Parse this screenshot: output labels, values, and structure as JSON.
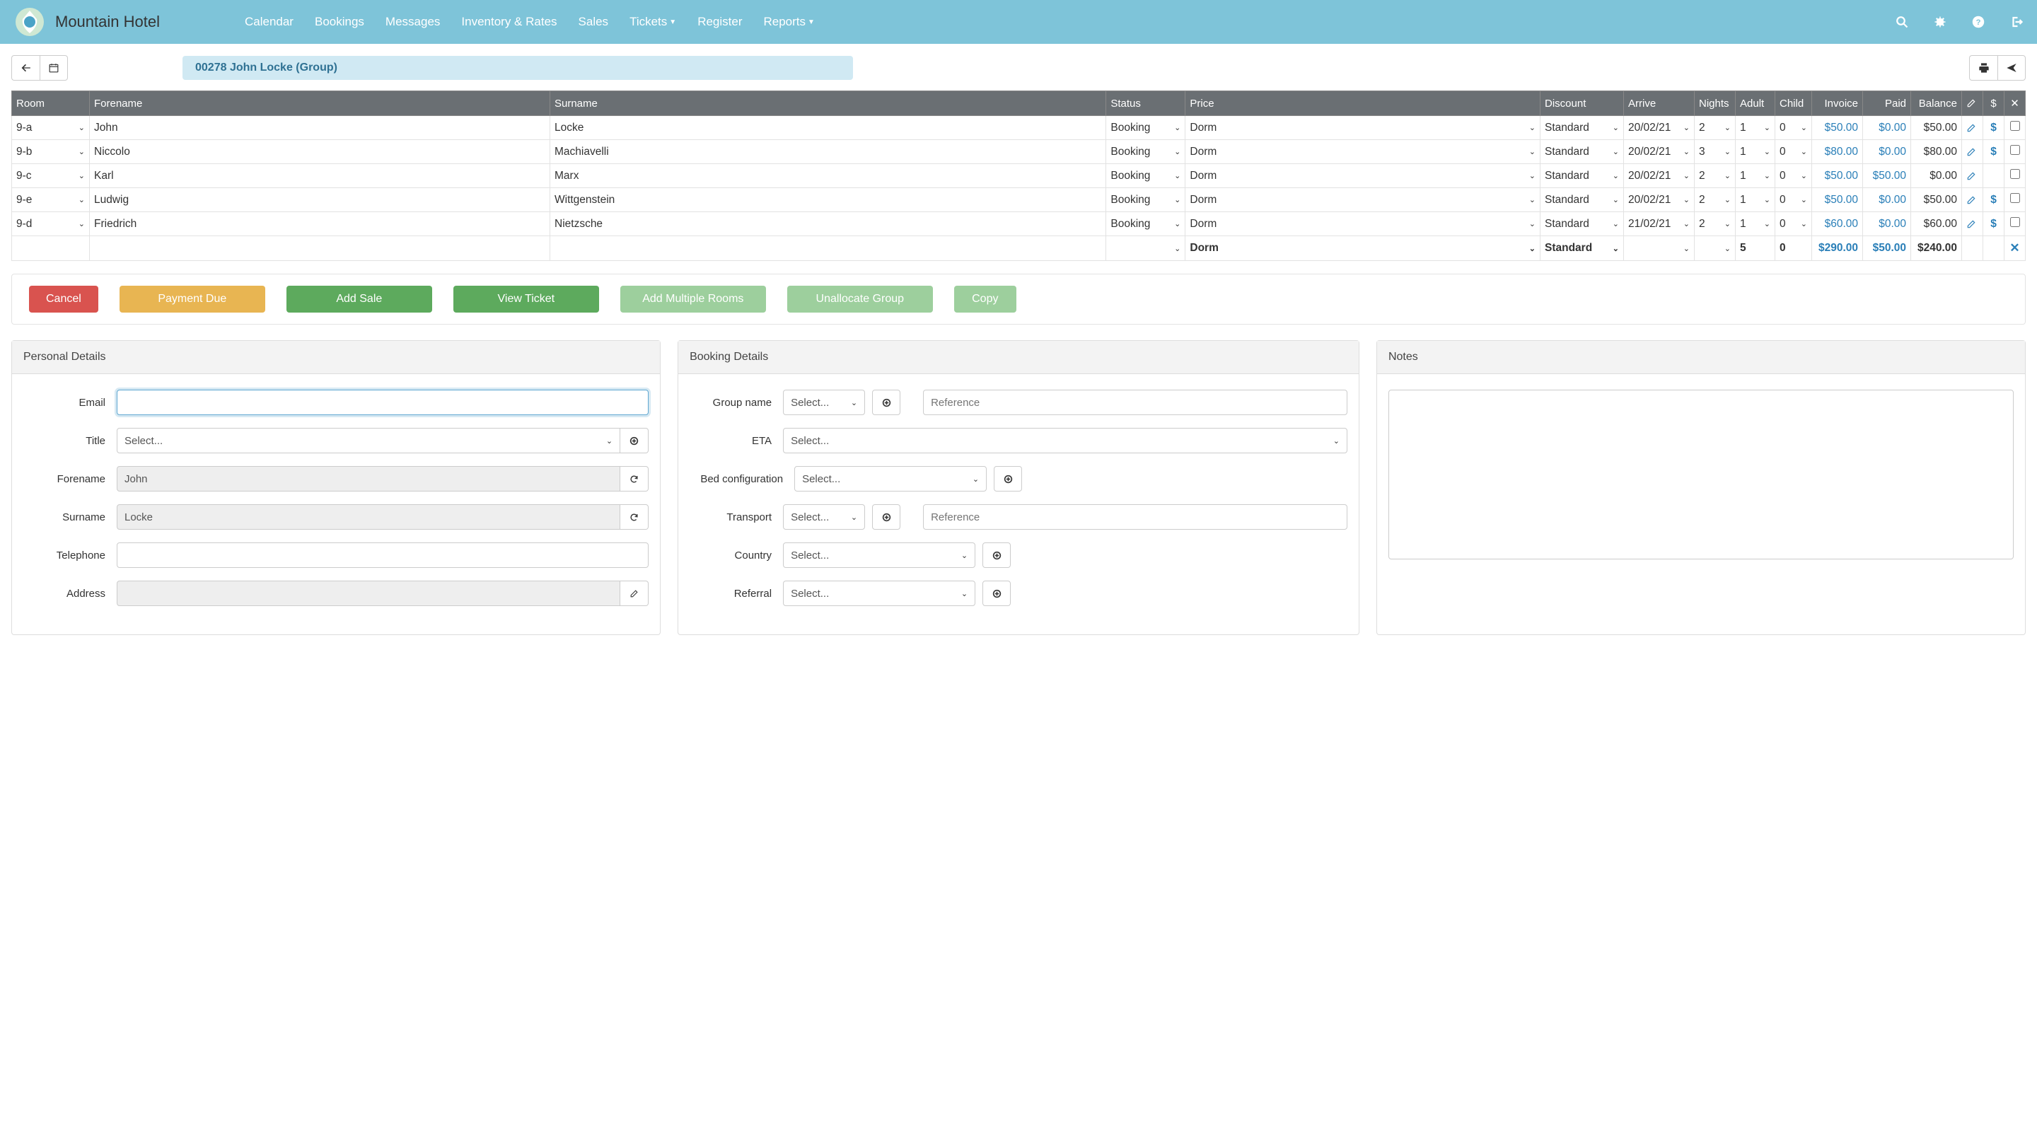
{
  "brand": "Mountain Hotel",
  "nav": {
    "items": [
      "Calendar",
      "Bookings",
      "Messages",
      "Inventory & Rates",
      "Sales",
      "Tickets",
      "Register",
      "Reports"
    ],
    "dropdown_flags": [
      false,
      false,
      false,
      false,
      false,
      true,
      false,
      true
    ]
  },
  "booking_pill": "00278  John Locke  (Group)",
  "columns": [
    "Room",
    "Forename",
    "Surname",
    "Status",
    "Price",
    "Discount",
    "Arrive",
    "Nights",
    "Adult",
    "Child",
    "Invoice",
    "Paid",
    "Balance"
  ],
  "rows": [
    {
      "room": "9-a",
      "forename": "John",
      "surname": "Locke",
      "status": "Booking",
      "price": "Dorm",
      "discount": "Standard",
      "arrive": "20/02/21",
      "nights": "2",
      "adult": "1",
      "child": "0",
      "invoice": "$50.00",
      "paid": "$0.00",
      "balance": "$50.00",
      "show_dollar": true
    },
    {
      "room": "9-b",
      "forename": "Niccolo",
      "surname": "Machiavelli",
      "status": "Booking",
      "price": "Dorm",
      "discount": "Standard",
      "arrive": "20/02/21",
      "nights": "3",
      "adult": "1",
      "child": "0",
      "invoice": "$80.00",
      "paid": "$0.00",
      "balance": "$80.00",
      "show_dollar": true
    },
    {
      "room": "9-c",
      "forename": "Karl",
      "surname": "Marx",
      "status": "Booking",
      "price": "Dorm",
      "discount": "Standard",
      "arrive": "20/02/21",
      "nights": "2",
      "adult": "1",
      "child": "0",
      "invoice": "$50.00",
      "paid": "$50.00",
      "balance": "$0.00",
      "show_dollar": false
    },
    {
      "room": "9-e",
      "forename": "Ludwig",
      "surname": "Wittgenstein",
      "status": "Booking",
      "price": "Dorm",
      "discount": "Standard",
      "arrive": "20/02/21",
      "nights": "2",
      "adult": "1",
      "child": "0",
      "invoice": "$50.00",
      "paid": "$0.00",
      "balance": "$50.00",
      "show_dollar": true
    },
    {
      "room": "9-d",
      "forename": "Friedrich",
      "surname": "Nietzsche",
      "status": "Booking",
      "price": "Dorm",
      "discount": "Standard",
      "arrive": "21/02/21",
      "nights": "2",
      "adult": "1",
      "child": "0",
      "invoice": "$60.00",
      "paid": "$0.00",
      "balance": "$60.00",
      "show_dollar": true
    }
  ],
  "totals": {
    "price": "Dorm",
    "discount": "Standard",
    "adult": "5",
    "child": "0",
    "invoice": "$290.00",
    "paid": "$50.00",
    "balance": "$240.00"
  },
  "actions": {
    "cancel": "Cancel",
    "payment_due": "Payment Due",
    "add_sale": "Add Sale",
    "view_ticket": "View Ticket",
    "add_rooms": "Add Multiple Rooms",
    "unallocate": "Unallocate Group",
    "copy": "Copy"
  },
  "personal": {
    "heading": "Personal Details",
    "labels": {
      "email": "Email",
      "title": "Title",
      "forename": "Forename",
      "surname": "Surname",
      "telephone": "Telephone",
      "address": "Address"
    },
    "values": {
      "forename": "John",
      "surname": "Locke"
    },
    "select_placeholder": "Select..."
  },
  "booking": {
    "heading": "Booking Details",
    "labels": {
      "group": "Group name",
      "eta": "ETA",
      "bed": "Bed configuration",
      "transport": "Transport",
      "country": "Country",
      "referral": "Referral"
    },
    "select_placeholder": "Select...",
    "reference_placeholder": "Reference"
  },
  "notes": {
    "heading": "Notes"
  }
}
